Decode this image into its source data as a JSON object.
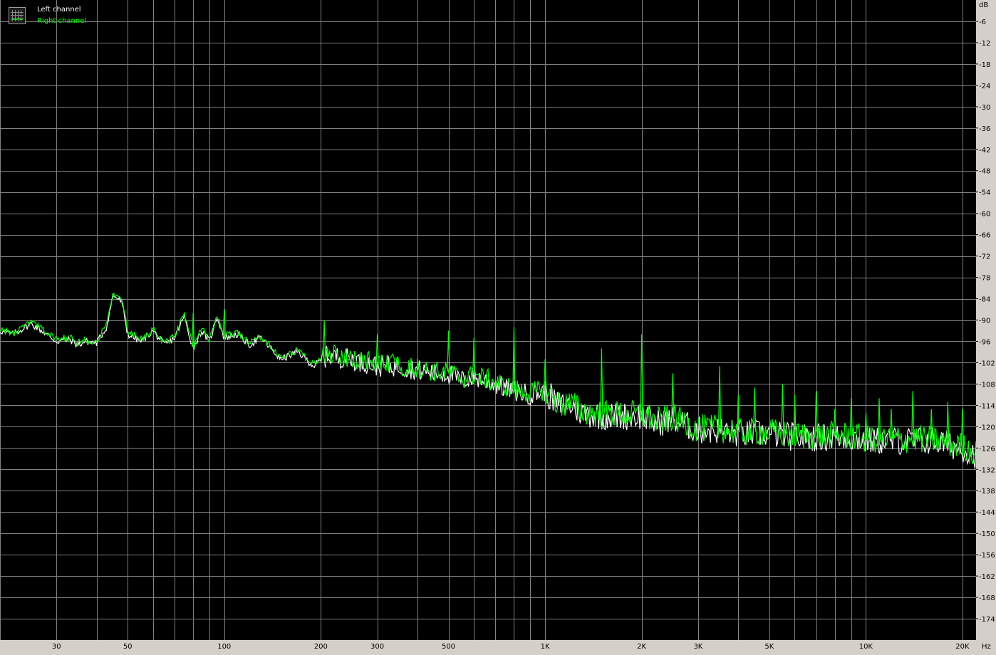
{
  "legend": {
    "icon": "chart-grid-icon",
    "left_label": "Left channel",
    "right_label": "Right channel"
  },
  "chart_data": {
    "type": "line",
    "title": "",
    "x_unit": "Hz",
    "y_unit": "dB",
    "x_scale": "log",
    "xlim": [
      20,
      22050
    ],
    "ylim": [
      -180,
      0
    ],
    "grid": true,
    "legend_placement": "top-left",
    "colors": {
      "background": "#000000",
      "grid": "#808080",
      "left": "#ffffff",
      "right": "#00ff00"
    },
    "x_ticks": [
      {
        "v": 30,
        "label": "30"
      },
      {
        "v": 50,
        "label": "50"
      },
      {
        "v": 100,
        "label": "100"
      },
      {
        "v": 200,
        "label": "200"
      },
      {
        "v": 300,
        "label": "300"
      },
      {
        "v": 500,
        "label": "500"
      },
      {
        "v": 1000,
        "label": "1K"
      },
      {
        "v": 2000,
        "label": "2K"
      },
      {
        "v": 3000,
        "label": "3K"
      },
      {
        "v": 5000,
        "label": "5K"
      },
      {
        "v": 10000,
        "label": "10K"
      },
      {
        "v": 20000,
        "label": "20K"
      }
    ],
    "y_ticks": [
      -6,
      -12,
      -18,
      -24,
      -30,
      -36,
      -42,
      -48,
      -54,
      -60,
      -66,
      -72,
      -78,
      -84,
      -90,
      -96,
      -102,
      -108,
      -114,
      -120,
      -126,
      -132,
      -138,
      -144,
      -150,
      -156,
      -162,
      -168,
      -174
    ],
    "series": [
      {
        "name": "Left channel",
        "color": "#ffffff",
        "x": [
          20,
          22,
          25,
          27,
          30,
          33,
          35,
          37,
          40,
          43,
          45,
          48,
          50,
          55,
          60,
          65,
          70,
          75,
          80,
          85,
          90,
          95,
          100,
          110,
          120,
          130,
          150,
          170,
          190,
          210,
          250,
          300,
          350,
          400,
          450,
          500,
          550,
          600,
          700,
          800,
          900,
          1000,
          1100,
          1200,
          1300,
          1500,
          1700,
          2000,
          2200,
          2500,
          3000,
          3500,
          4000,
          4500,
          5000,
          6000,
          7000,
          8000,
          9000,
          10000,
          12000,
          14000,
          16000,
          18000,
          20000,
          22050
        ],
        "y": [
          -93,
          -94,
          -91,
          -93,
          -96,
          -95.5,
          -97,
          -96,
          -96.5,
          -92,
          -83,
          -85,
          -94,
          -96,
          -93,
          -97,
          -95,
          -89,
          -98,
          -93,
          -96,
          -89,
          -95,
          -94,
          -97,
          -95,
          -101,
          -99,
          -103,
          -100,
          -101,
          -103,
          -103,
          -104,
          -105,
          -105,
          -107,
          -106,
          -108,
          -110,
          -111,
          -110,
          -114,
          -114,
          -116,
          -117,
          -117,
          -117,
          -119,
          -118,
          -121,
          -121,
          -122,
          -122,
          -122,
          -123,
          -123,
          -123,
          -123,
          -124,
          -124,
          -124,
          -124,
          -125,
          -126,
          -128
        ]
      },
      {
        "name": "Right channel",
        "color": "#00ff00",
        "x": [
          20,
          22,
          25,
          27,
          30,
          33,
          35,
          37,
          40,
          43,
          45,
          48,
          50,
          55,
          60,
          65,
          70,
          75,
          80,
          85,
          90,
          95,
          100,
          110,
          120,
          130,
          150,
          170,
          190,
          210,
          250,
          300,
          350,
          400,
          450,
          500,
          550,
          600,
          700,
          800,
          900,
          1000,
          1100,
          1200,
          1300,
          1500,
          1700,
          2000,
          2200,
          2500,
          3000,
          3500,
          4000,
          4500,
          5000,
          6000,
          7000,
          8000,
          9000,
          10000,
          12000,
          14000,
          16000,
          18000,
          20000,
          22050
        ],
        "y": [
          -92.5,
          -94,
          -90.5,
          -92.5,
          -95.5,
          -95,
          -96.5,
          -95.5,
          -96,
          -91.5,
          -82.5,
          -84.5,
          -93.5,
          -95.5,
          -92.5,
          -96.5,
          -94.5,
          -88.5,
          -97.5,
          -92.5,
          -95.5,
          -88.5,
          -94.5,
          -93.5,
          -96.5,
          -94.5,
          -100.5,
          -98.5,
          -102.5,
          -99.5,
          -100.5,
          -102.5,
          -102.5,
          -103.5,
          -104.5,
          -104.5,
          -106.5,
          -105.5,
          -107.5,
          -109.5,
          -110.5,
          -109.5,
          -113.5,
          -113.5,
          -115.5,
          -116.5,
          -116.5,
          -116.5,
          -118.5,
          -117.5,
          -120.5,
          -120.5,
          -121.5,
          -121.5,
          -121.5,
          -122.5,
          -122.5,
          -122.5,
          -122.5,
          -123.5,
          -123.5,
          -123.5,
          -123.5,
          -124.5,
          -125.5,
          -127.5
        ]
      }
    ],
    "spikes": {
      "x": [
        45,
        80,
        100,
        205,
        300,
        500,
        600,
        800,
        1000,
        1500,
        2000,
        2500,
        3500,
        4000,
        4500,
        5500,
        6000,
        7000,
        8000,
        9000,
        10000,
        11000,
        12000,
        14000,
        16000,
        18000,
        20000
      ],
      "y": [
        -83,
        -88,
        -87,
        -90,
        -94,
        -93,
        -95,
        -92,
        -101,
        -98,
        -94,
        -105,
        -103,
        -111,
        -109,
        -108,
        -111,
        -110,
        -115,
        -112,
        -116,
        -112,
        -115,
        -110,
        -115,
        -113,
        -115
      ]
    }
  }
}
